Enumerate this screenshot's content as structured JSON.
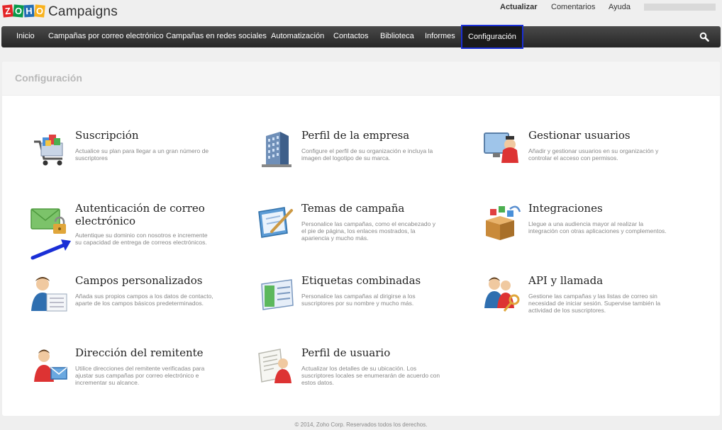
{
  "header": {
    "brand": "Campaigns",
    "zoho_letters": [
      "Z",
      "O",
      "H",
      "O"
    ],
    "links": {
      "upgrade": "Actualizar",
      "feedback": "Comentarios",
      "help": "Ayuda"
    }
  },
  "nav": {
    "items": [
      {
        "label": "Inicio"
      },
      {
        "label": "Campañas por correo electrónico"
      },
      {
        "label": "Campañas en redes sociales"
      },
      {
        "label": "Automatización"
      },
      {
        "label": "Contactos"
      },
      {
        "label": "Biblioteca"
      },
      {
        "label": "Informes"
      },
      {
        "label": "Configuración"
      }
    ],
    "active": "Configuración",
    "search_icon": "search-icon"
  },
  "page": {
    "title": "Configuración"
  },
  "cards": [
    {
      "title": "Suscripción",
      "desc": "Actualice su plan para llegar a un gran número de suscriptores",
      "icon": "shopping-cart-icon"
    },
    {
      "title": "Perfil de la empresa",
      "desc": "Configure el perfil de su organización e incluya la imagen del logotipo de su marca.",
      "icon": "building-icon"
    },
    {
      "title": "Gestionar usuarios",
      "desc": "Añadir y gestionar usuarios en su organización y controlar el acceso con permisos.",
      "icon": "user-monitor-icon"
    },
    {
      "title": "Autenticación de correo electrónico",
      "desc": "Autentique su dominio con nosotros e incremente su capacidad de entrega de correos electrónicos.",
      "icon": "envelope-lock-icon"
    },
    {
      "title": "Temas de campaña",
      "desc": "Personalice las campañas, como el encabezado y el pie de página, los enlaces mostrados, la apariencia y mucho más.",
      "icon": "theme-pen-icon"
    },
    {
      "title": "Integraciones",
      "desc": "Llegue a una audiencia mayor al realizar la integración con otras aplicaciones y complementos.",
      "icon": "integration-box-icon"
    },
    {
      "title": "Campos personalizados",
      "desc": "Añada sus propios campos a los datos de contacto, aparte de los campos básicos predeterminados.",
      "icon": "custom-fields-user-icon"
    },
    {
      "title": "Etiquetas combinadas",
      "desc": "Personalice las campañas al dirigirse a los suscriptores por su nombre y mucho más.",
      "icon": "merge-tags-icon"
    },
    {
      "title": "API y llamada",
      "desc": "Gestione las campañas y las listas de correo sin necesidad de iniciar sesión. Supervise también la actividad de los suscriptores.",
      "icon": "api-users-key-icon"
    },
    {
      "title": "Dirección del remitente",
      "desc": "Utilice direcciones del remitente verificadas para ajustar sus campañas por correo electrónico e incrementar su alcance.",
      "icon": "sender-address-icon"
    },
    {
      "title": "Perfil de usuario",
      "desc": "Actualizar los detalles de su ubicación. Los suscriptores locales se enumerarán de acuerdo con estos datos.",
      "icon": "user-profile-icon"
    }
  ],
  "footer": {
    "text": "© 2014, Zoho Corp. Reservados todos los derechos."
  },
  "colors": {
    "nav_active_border": "#1a2fd6",
    "arrow": "#1a2fd6"
  }
}
